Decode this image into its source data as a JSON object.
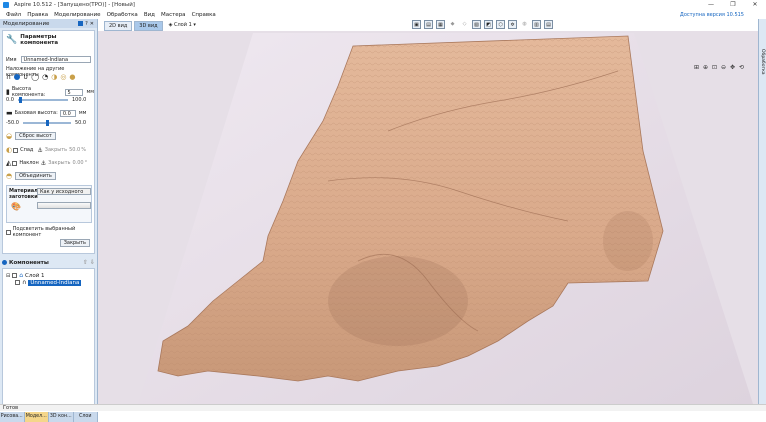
{
  "window": {
    "title": "Aspire 10.512 - [Запущено(ТРО)] - [Новый]",
    "controls": {
      "minimize": "—",
      "maximize": "❐",
      "close": "✕"
    }
  },
  "menu": {
    "items": [
      "Файл",
      "Правка",
      "Моделирование",
      "Обработка",
      "Вид",
      "Мастера",
      "Справка"
    ],
    "notice": "Доступна версия 10.515"
  },
  "left_panel": {
    "header": "Моделирование",
    "header_icons": [
      "pin-icon",
      "help-icon",
      "close-icon"
    ],
    "section_title": "Параметры компонента",
    "name_label": "Имя",
    "name_value": "Unnamed-Indiana",
    "overlay_label": "Наложение на другие компоненты",
    "height_label": "Высота компонента:",
    "height_value": "5",
    "height_unit": "мм",
    "height_min": "0.0",
    "height_max": "100.0",
    "base_label": "Базовая высота:",
    "base_value": "0.0",
    "base_unit": "мм",
    "base_min": "-50.0",
    "base_max": "50.0",
    "reset_button": "Сброс высот",
    "fade_label": "Спад",
    "fade_close": "Закрыть",
    "fade_value": "50.0",
    "fade_unit": "%",
    "tilt_label": "Наклон",
    "tilt_close": "Закрыть",
    "tilt_value": "0.00",
    "tilt_unit": "°",
    "merge_button": "Объединить",
    "material_label": "Материал заготовки",
    "material_value": "Как у исходного",
    "highlight_label": "Подсветить выбранный компонент",
    "close_button": "Закрыть"
  },
  "components": {
    "header": "Компоненты",
    "layer": "Слой 1",
    "item": "Unnamed-Indiana"
  },
  "bottom_tabs": [
    "Рисова...",
    "Модел...",
    "3D кон...",
    "Слои"
  ],
  "view": {
    "tab_2d": "2D вид",
    "tab_3d": "3D вид",
    "layer_select": "Слой 1"
  },
  "right_sidebar": "Обработка",
  "status_text": "Готов",
  "colors": {
    "accent": "#1565c0",
    "panel_bg": "#dde8f4",
    "viewport_bg": "#e6dfe7",
    "relief": "#d9a98a"
  }
}
